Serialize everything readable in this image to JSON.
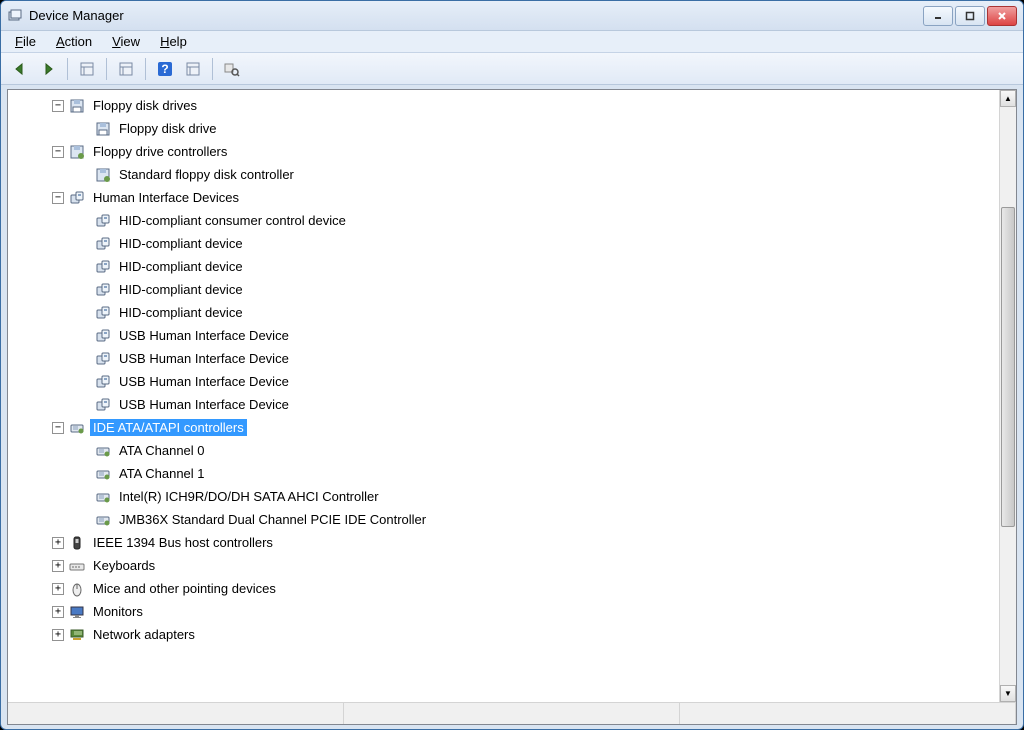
{
  "window": {
    "title": "Device Manager"
  },
  "menubar": {
    "items": [
      {
        "label": "File",
        "accel": "F"
      },
      {
        "label": "Action",
        "accel": "A"
      },
      {
        "label": "View",
        "accel": "V"
      },
      {
        "label": "Help",
        "accel": "H"
      }
    ]
  },
  "toolbar": {
    "items": [
      {
        "name": "back-icon",
        "glyph": "⬅"
      },
      {
        "name": "forward-icon",
        "glyph": "➡"
      },
      {
        "sep": true
      },
      {
        "name": "show-hide-console-tree-icon",
        "glyph": "▤"
      },
      {
        "sep": true
      },
      {
        "name": "properties-icon",
        "glyph": "☰"
      },
      {
        "sep": true
      },
      {
        "name": "help-icon",
        "glyph": "?"
      },
      {
        "name": "scan-hardware-icon",
        "glyph": "▦"
      },
      {
        "sep": true
      },
      {
        "name": "detail-icon",
        "glyph": "🔍"
      }
    ]
  },
  "tree": {
    "nodes": [
      {
        "label": "Floppy disk drives",
        "icon": "floppy-category-icon",
        "expanded": true,
        "children": [
          {
            "label": "Floppy disk drive",
            "icon": "floppy-icon"
          }
        ]
      },
      {
        "label": "Floppy drive controllers",
        "icon": "floppy-controller-category-icon",
        "expanded": true,
        "children": [
          {
            "label": "Standard floppy disk controller",
            "icon": "floppy-controller-icon"
          }
        ]
      },
      {
        "label": "Human Interface Devices",
        "icon": "hid-category-icon",
        "expanded": true,
        "children": [
          {
            "label": "HID-compliant consumer control device",
            "icon": "hid-icon"
          },
          {
            "label": "HID-compliant device",
            "icon": "hid-icon"
          },
          {
            "label": "HID-compliant device",
            "icon": "hid-icon"
          },
          {
            "label": "HID-compliant device",
            "icon": "hid-icon"
          },
          {
            "label": "HID-compliant device",
            "icon": "hid-icon"
          },
          {
            "label": "USB Human Interface Device",
            "icon": "hid-icon"
          },
          {
            "label": "USB Human Interface Device",
            "icon": "hid-icon"
          },
          {
            "label": "USB Human Interface Device",
            "icon": "hid-icon"
          },
          {
            "label": "USB Human Interface Device",
            "icon": "hid-icon"
          }
        ]
      },
      {
        "label": "IDE ATA/ATAPI controllers",
        "icon": "ide-category-icon",
        "expanded": true,
        "selected": true,
        "children": [
          {
            "label": "ATA Channel 0",
            "icon": "ata-icon"
          },
          {
            "label": "ATA Channel 1",
            "icon": "ata-icon"
          },
          {
            "label": "Intel(R) ICH9R/DO/DH SATA AHCI Controller",
            "icon": "ata-icon"
          },
          {
            "label": "JMB36X Standard Dual Channel PCIE IDE Controller",
            "icon": "ata-icon"
          }
        ]
      },
      {
        "label": "IEEE 1394 Bus host controllers",
        "icon": "ieee1394-icon",
        "expanded": false
      },
      {
        "label": "Keyboards",
        "icon": "keyboard-icon",
        "expanded": false
      },
      {
        "label": "Mice and other pointing devices",
        "icon": "mouse-icon",
        "expanded": false
      },
      {
        "label": "Monitors",
        "icon": "monitor-icon",
        "expanded": false
      },
      {
        "label": "Network adapters",
        "icon": "network-icon",
        "expanded": false
      }
    ]
  },
  "expander": {
    "expanded": "−",
    "collapsed": "+"
  }
}
